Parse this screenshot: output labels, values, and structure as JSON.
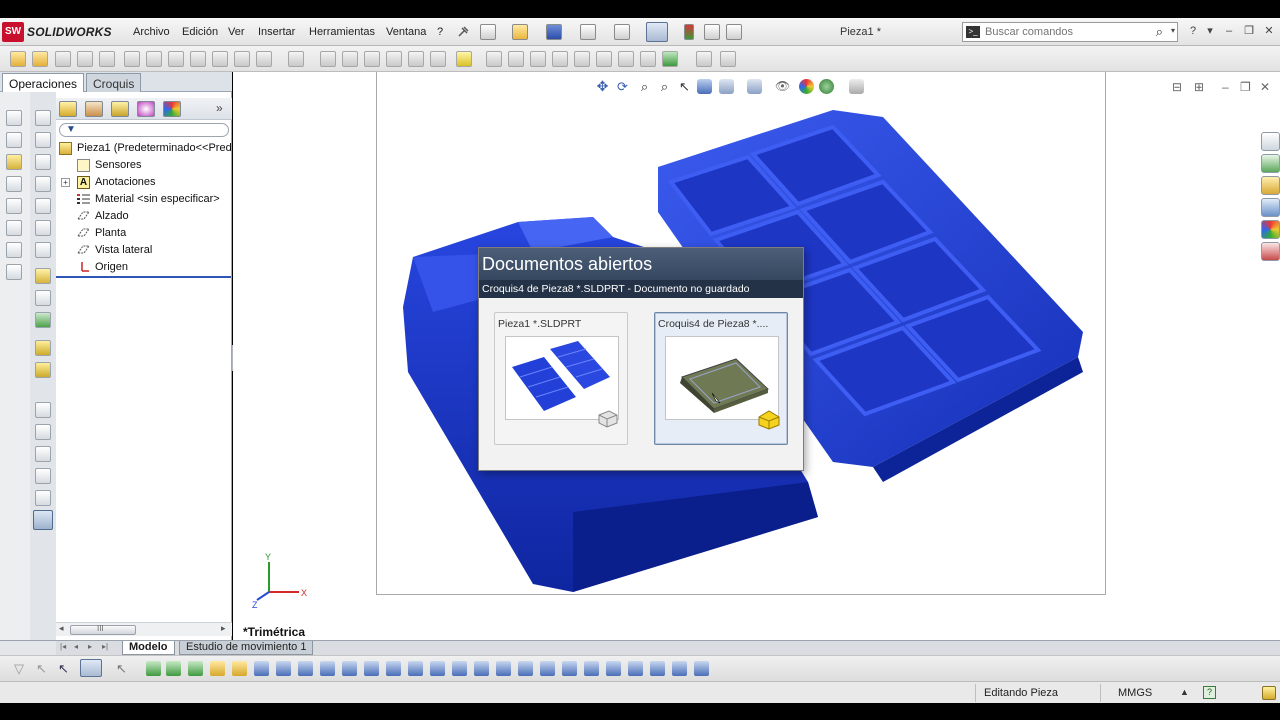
{
  "app": {
    "brand_badge": "SW",
    "brand_name": "SOLIDWORKS",
    "doc_title": "Pieza1 *"
  },
  "menu": [
    "Archivo",
    "Edición",
    "Ver",
    "Insertar",
    "Herramientas",
    "Ventana",
    "?"
  ],
  "search": {
    "placeholder": "Buscar comandos"
  },
  "window_controls": [
    "?",
    "▾",
    "–",
    "❐",
    "✕"
  ],
  "feature_manager": {
    "tabs": [
      "Operaciones",
      "Croquis"
    ],
    "expand_label": "»",
    "tree": [
      {
        "label": "Pieza1  (Predeterminado<<Pred",
        "icon": "part-icon",
        "level": 0
      },
      {
        "label": "Sensores",
        "icon": "sensor-icon",
        "level": 1
      },
      {
        "label": "Anotaciones",
        "icon": "annotation-icon",
        "level": 1,
        "expandable": true
      },
      {
        "label": "Material <sin especificar>",
        "icon": "material-icon",
        "level": 1
      },
      {
        "label": "Alzado",
        "icon": "plane-icon",
        "level": 1
      },
      {
        "label": "Planta",
        "icon": "plane-icon",
        "level": 1
      },
      {
        "label": "Vista lateral",
        "icon": "plane-icon",
        "level": 1
      },
      {
        "label": "Origen",
        "icon": "origin-icon",
        "level": 1
      }
    ],
    "scroll_label": "III"
  },
  "graphics": {
    "view_label": "*Trimétrica",
    "axes": {
      "x": "X",
      "y": "Y",
      "z": "Z"
    },
    "model_color": "#1c3ed6"
  },
  "open_documents_dialog": {
    "title": "Documentos abiertos",
    "subtitle": "Croquis4 de Pieza8 *.SLDPRT - Documento no guardado",
    "documents": [
      {
        "name": "Pieza1 *.SLDPRT",
        "selected": false
      },
      {
        "name": "Croquis4 de Pieza8 *....",
        "selected": true
      }
    ]
  },
  "bottom_tabs": [
    "Modelo",
    "Estudio de movimiento 1"
  ],
  "status": {
    "editing": "Editando Pieza",
    "units": "MMGS",
    "arrow": "▲",
    "help": "?"
  },
  "colors": {
    "title_bar": "#3d4f68",
    "accent_red": "#c8102e",
    "selection": "#6f87a6"
  }
}
